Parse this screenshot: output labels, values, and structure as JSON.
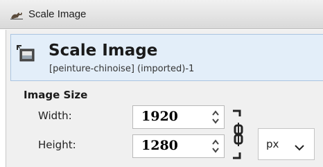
{
  "window": {
    "title": "Scale Image",
    "app_icon": "gimp-wilber-icon"
  },
  "header": {
    "icon": "scale-image-icon",
    "title": "Scale Image",
    "subtitle": "[peinture-chinoise] (imported)-1"
  },
  "image_size": {
    "section_title": "Image Size",
    "width_label": "Width:",
    "width_value": "1920",
    "height_label": "Height:",
    "height_value": "1280",
    "chain_icon": "chain-link-icon",
    "unit_value": "px"
  }
}
